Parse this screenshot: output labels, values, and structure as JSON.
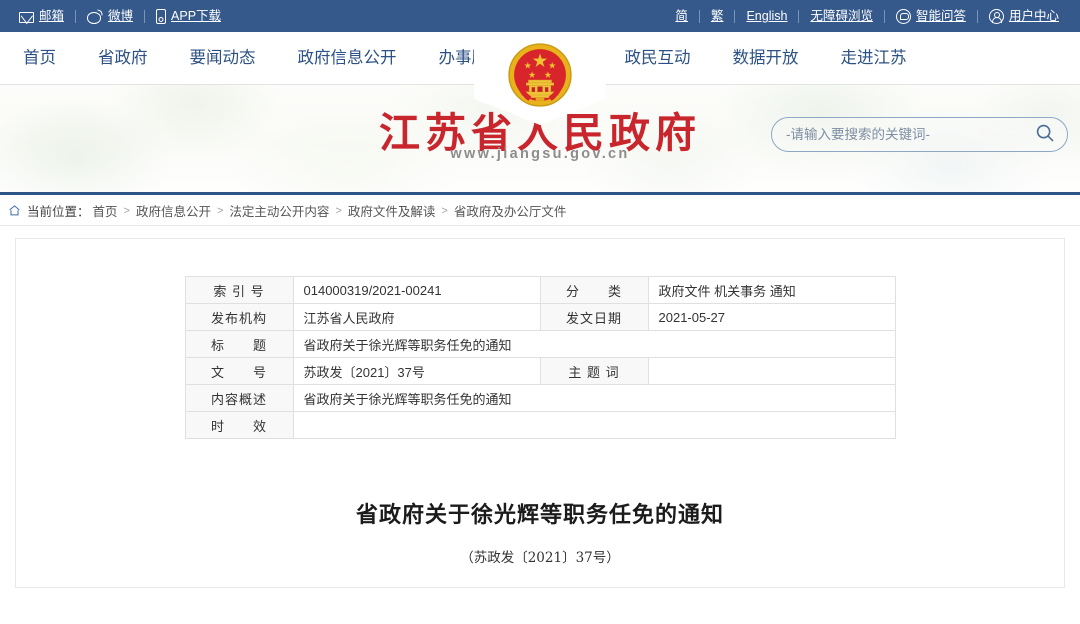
{
  "topbar": {
    "left_items": [
      {
        "icon": "mail-icon",
        "label": "邮箱"
      },
      {
        "icon": "weibo-icon",
        "label": "微博"
      },
      {
        "icon": "phone-icon",
        "label": "APP下载"
      }
    ],
    "right_items": [
      {
        "icon": "",
        "label": "简"
      },
      {
        "icon": "",
        "label": "繁"
      },
      {
        "icon": "",
        "label": "English"
      },
      {
        "icon": "",
        "label": "无障碍浏览"
      },
      {
        "icon": "qa-robot-icon",
        "label": "智能问答"
      },
      {
        "icon": "user-icon",
        "label": "用户中心"
      }
    ],
    "bg_color": "#36598c"
  },
  "nav": {
    "left": [
      "首页",
      "省政府",
      "要闻动态",
      "政府信息公开",
      "办事服务"
    ],
    "right": [
      "政民互动",
      "数据开放",
      "走进江苏"
    ],
    "link_color": "#2c5185"
  },
  "banner": {
    "emblem": "national-emblem-icon",
    "title": "江苏省人民政府",
    "title_color": "#c9252c",
    "url": "www.jiangsu.gov.cn",
    "search": {
      "placeholder": "-请输入要搜索的关键词-",
      "value": "",
      "button_icon": "search-icon"
    }
  },
  "breadcrumb": {
    "home_icon": "home-icon",
    "label": "当前位置：",
    "separator": ">",
    "items": [
      "首页",
      "政府信息公开",
      "法定主动公开内容",
      "政府文件及解读",
      "省政府及办公厅文件"
    ]
  },
  "document": {
    "meta_rows": [
      {
        "k1": "索 引 号",
        "v1": "014000319/2021-00241",
        "k2": "分　　类",
        "v2": "政府文件 机关事务 通知"
      },
      {
        "k1": "发布机构",
        "v1": "江苏省人民政府",
        "k2": "发文日期",
        "v2": "2021-05-27"
      },
      {
        "k1": "标　　题",
        "v1": "省政府关于徐光辉等职务任免的通知"
      },
      {
        "k1": "文　　号",
        "v1": "苏政发〔2021〕37号",
        "k2": "主 题 词",
        "v2": ""
      },
      {
        "k1": "内容概述",
        "v1": "省政府关于徐光辉等职务任免的通知"
      },
      {
        "k1": "时　　效",
        "v1": ""
      }
    ],
    "title": "省政府关于徐光辉等职务任免的通知",
    "subtitle": "（苏政发〔2021〕37号）"
  }
}
